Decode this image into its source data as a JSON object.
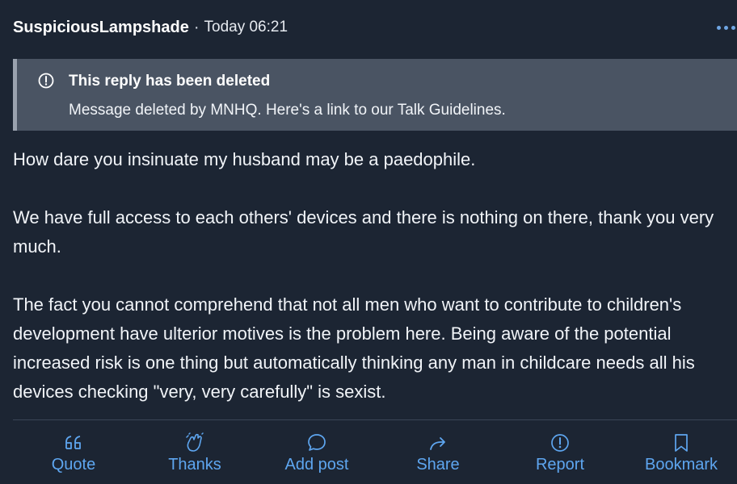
{
  "post": {
    "author": "SuspiciousLampshade",
    "separator": "·",
    "timestamp": "Today 06:21"
  },
  "deleted_notice": {
    "title": "This reply has been deleted",
    "body_prefix": "Message deleted by MNHQ. Here's a link to our ",
    "link_text": "Talk Guidelines",
    "body_suffix": "."
  },
  "body": {
    "paragraphs": [
      "How dare you insinuate my husband may be a paedophile.",
      "We have full access to each others' devices and there is nothing on there, thank you very much.",
      "The fact you cannot comprehend that not all men who want to contribute to children's development have ulterior motives is the problem here. Being aware of the potential increased risk is one thing but automatically thinking any man in childcare needs all his devices checking \"very, very carefully\" is sexist."
    ]
  },
  "actions": [
    {
      "label": "Quote",
      "icon": "quote-icon"
    },
    {
      "label": "Thanks",
      "icon": "clap-icon"
    },
    {
      "label": "Add post",
      "icon": "comment-icon"
    },
    {
      "label": "Share",
      "icon": "share-icon"
    },
    {
      "label": "Report",
      "icon": "report-icon"
    },
    {
      "label": "Bookmark",
      "icon": "bookmark-icon"
    }
  ],
  "colors": {
    "background": "#1c2533",
    "notice_background": "#4a5463",
    "accent": "#5ea6f0"
  }
}
